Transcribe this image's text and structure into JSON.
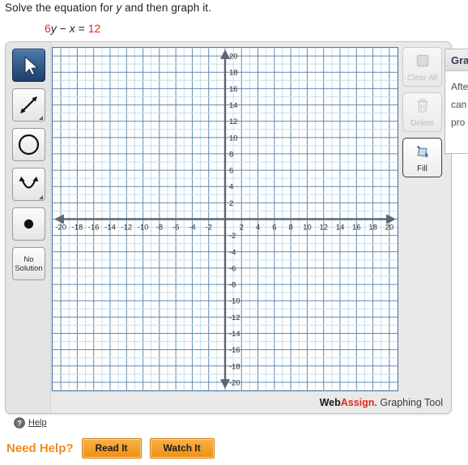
{
  "prompt": {
    "text_before": "Solve the equation for ",
    "variable": "y",
    "text_after": " and then graph it."
  },
  "equation": {
    "coefficient": "6",
    "var_y": "y",
    "minus": "−",
    "var_x": "x",
    "equals": "=",
    "constant": "12",
    "full": "6y − x = 12",
    "number_color": "#e8281e"
  },
  "graphing_tool": {
    "left_toolbar": [
      {
        "name": "select",
        "label": "",
        "selected": true,
        "has_corner": false
      },
      {
        "name": "line",
        "label": "",
        "selected": false,
        "has_corner": true
      },
      {
        "name": "circle",
        "label": "",
        "selected": false,
        "has_corner": false
      },
      {
        "name": "parabola",
        "label": "",
        "selected": false,
        "has_corner": true
      },
      {
        "name": "point",
        "label": "",
        "selected": false,
        "has_corner": false
      },
      {
        "name": "no-solution",
        "label": "No\nSolution",
        "label_line1": "No",
        "label_line2": "Solution",
        "selected": false,
        "has_corner": false
      }
    ],
    "right_toolbar": [
      {
        "name": "clear-all",
        "label": "Clear All",
        "enabled": false
      },
      {
        "name": "delete",
        "label": "Delete",
        "enabled": false
      },
      {
        "name": "fill",
        "label": "Fill",
        "enabled": true
      }
    ],
    "help_label": "Help",
    "branding": {
      "web": "Web",
      "assign": "Assign.",
      "product": "Graphing Tool"
    }
  },
  "chart_data": {
    "type": "scatter",
    "title": "",
    "xlabel": "",
    "ylabel": "",
    "xlim": [
      -21,
      21
    ],
    "ylim": [
      -21,
      21
    ],
    "grid": true,
    "minor_step": 1,
    "major_step": 2,
    "x_ticks": [
      -20,
      -18,
      -16,
      -14,
      -12,
      -10,
      -8,
      -6,
      -4,
      -2,
      2,
      4,
      6,
      8,
      10,
      12,
      14,
      16,
      18,
      20
    ],
    "y_ticks": [
      20,
      18,
      16,
      14,
      12,
      10,
      8,
      6,
      4,
      2,
      -2,
      -4,
      -6,
      -8,
      -10,
      -12,
      -14,
      -16,
      -18,
      -20
    ],
    "origin_label": "",
    "series": [],
    "axis_color": "#5a6673",
    "major_grid_color": "#5d8cb3",
    "minor_grid_color": "#c5ddee",
    "plot_background": "#ffffff"
  },
  "side_panel": {
    "header": "Grap",
    "lines": [
      "Afte",
      "can",
      "pro"
    ]
  },
  "need_help": {
    "label": "Need Help?",
    "buttons": [
      {
        "name": "read-it",
        "label": "Read It"
      },
      {
        "name": "watch-it",
        "label": "Watch It"
      }
    ]
  }
}
